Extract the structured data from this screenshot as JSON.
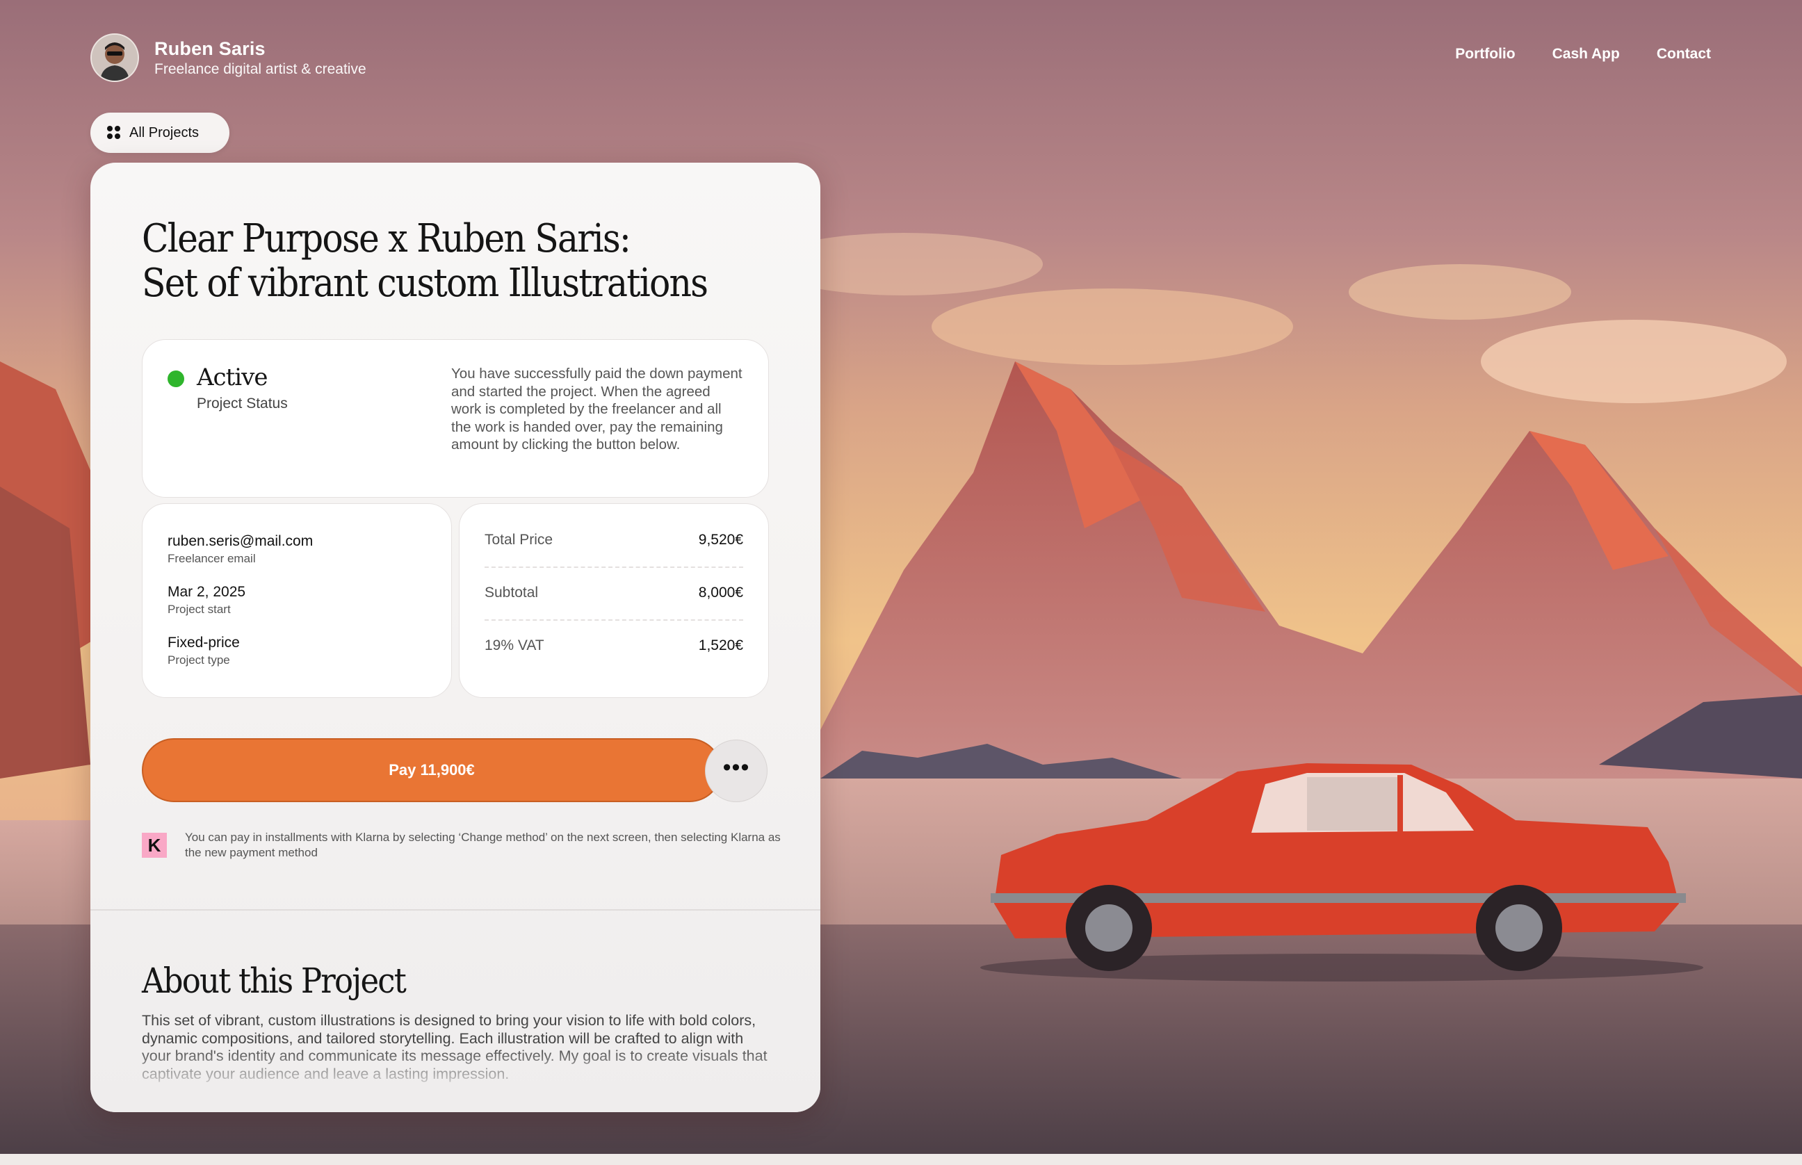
{
  "profile": {
    "name": "Ruben Saris",
    "tagline": "Freelance digital artist & creative"
  },
  "nav": {
    "items": [
      "Portfolio",
      "Cash App",
      "Contact"
    ]
  },
  "all_projects_label": "All Projects",
  "project": {
    "title_line1": "Clear Purpose x Ruben Saris:",
    "title_line2": "Set of vibrant custom Illustrations",
    "status": {
      "value": "Active",
      "label": "Project Status",
      "color": "#2fb52c",
      "description": "You have successfully paid the down payment and started the project. When the agreed work is completed by the freelancer and all the work is handed over, pay the remaining amount by clicking the button below."
    },
    "info": [
      {
        "value": "ruben.seris@mail.com",
        "label": "Freelancer email"
      },
      {
        "value": "Mar 2, 2025",
        "label": "Project start"
      },
      {
        "value": "Fixed-price",
        "label": "Project type"
      }
    ],
    "prices": [
      {
        "label": "Total Price",
        "value": "9,520€"
      },
      {
        "label": "Subtotal",
        "value": "8,000€"
      },
      {
        "label": "19% VAT",
        "value": "1,520€"
      }
    ],
    "pay_button": "Pay 11,900€",
    "more_button": "•••",
    "klarna": {
      "logo": "K",
      "note": "You can pay in installments with Klarna by selecting  ‘Change method’ on the next screen, then selecting Klarna as the new payment method"
    },
    "about": {
      "title": "About this Project",
      "body": "This set of vibrant, custom illustrations is designed to bring your vision to life with bold colors, dynamic compositions, and tailored storytelling. Each illustration will be crafted to align with your brand's identity and communicate its message effectively. My goal is to create visuals that captivate your audience and leave a lasting impression."
    }
  },
  "colors": {
    "accent": "#e97534",
    "status_active": "#2fb52c",
    "klarna_pink": "#f9a8c6"
  }
}
